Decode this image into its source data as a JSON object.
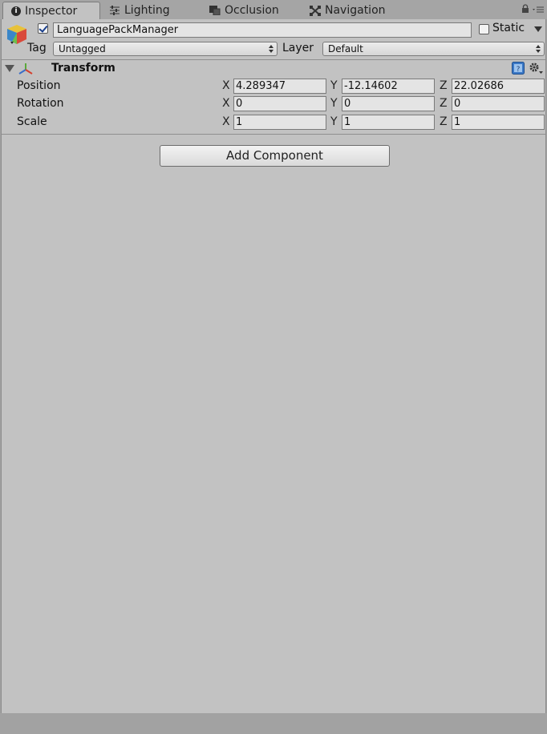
{
  "tabs": [
    {
      "label": "Inspector",
      "icon": "info-icon",
      "active": true
    },
    {
      "label": "Lighting",
      "icon": "lighting-icon",
      "active": false
    },
    {
      "label": "Occlusion",
      "icon": "occlusion-icon",
      "active": false
    },
    {
      "label": "Navigation",
      "icon": "navigation-icon",
      "active": false
    }
  ],
  "gameobject": {
    "name": "LanguagePackManager",
    "active": true,
    "static_label": "Static",
    "static_checked": false,
    "tag_label": "Tag",
    "tag_value": "Untagged",
    "layer_label": "Layer",
    "layer_value": "Default"
  },
  "transform": {
    "title": "Transform",
    "rows": [
      {
        "label": "Position",
        "x": "4.289347",
        "y": "-12.14602",
        "z": "22.02686"
      },
      {
        "label": "Rotation",
        "x": "0",
        "y": "0",
        "z": "0"
      },
      {
        "label": "Scale",
        "x": "1",
        "y": "1",
        "z": "1"
      }
    ],
    "axis_labels": {
      "x": "X",
      "y": "Y",
      "z": "Z"
    }
  },
  "add_component_label": "Add Component",
  "colors": {
    "panel_bg": "#c2c2c2",
    "tab_bg": "#a5a5a5",
    "field_bg": "#e4e4e4",
    "checkbox_check": "#1a3f8c"
  }
}
